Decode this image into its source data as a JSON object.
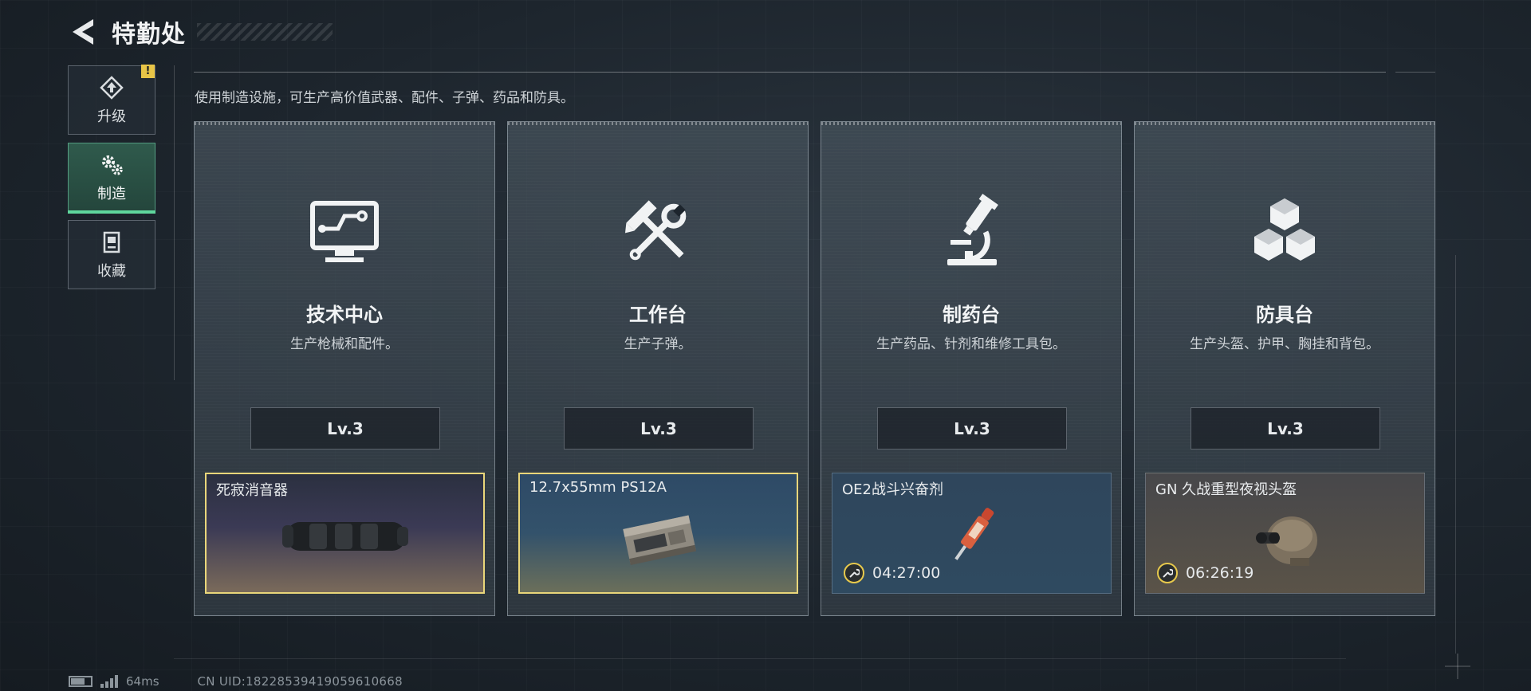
{
  "header": {
    "title": "特勤处"
  },
  "sidebar": {
    "items": [
      {
        "label": "升级",
        "icon": "upgrade-icon",
        "active": false,
        "badge": "!"
      },
      {
        "label": "制造",
        "icon": "crafting-gears-icon",
        "active": true
      },
      {
        "label": "收藏",
        "icon": "collection-icon",
        "active": false
      }
    ]
  },
  "main": {
    "description": "使用制造设施，可生产高价值武器、配件、子弹、药品和防具。",
    "cards": [
      {
        "title": "技术中心",
        "subtitle": "生产枪械和配件。",
        "icon": "computer-monitor-icon",
        "level": "Lv.3",
        "item": {
          "name": "死寂消音器",
          "status": "completed",
          "timer": "",
          "image": "suppressor"
        }
      },
      {
        "title": "工作台",
        "subtitle": "生产子弹。",
        "icon": "hammer-wrench-icon",
        "level": "Lv.3",
        "item": {
          "name": "12.7x55mm PS12A",
          "status": "completed",
          "timer": "",
          "image": "ammo-box"
        }
      },
      {
        "title": "制药台",
        "subtitle": "生产药品、针剂和维修工具包。",
        "icon": "microscope-icon",
        "level": "Lv.3",
        "item": {
          "name": "OE2战斗兴奋剂",
          "status": "in-progress",
          "timer": "04:27:00",
          "image": "syringe"
        }
      },
      {
        "title": "防具台",
        "subtitle": "生产头盔、护甲、胸挂和背包。",
        "icon": "armor-cubes-icon",
        "level": "Lv.3",
        "item": {
          "name": "GN 久战重型夜视头盔",
          "status": "in-progress",
          "timer": "06:26:19",
          "image": "nv-helmet"
        }
      }
    ]
  },
  "footer": {
    "ping": "64ms",
    "uid": "CN UID:18228539419059610668"
  },
  "colors": {
    "accent_green": "#5fd69c",
    "completed_border": "#e9d67a",
    "badge_yellow": "#e8c547",
    "timer_ring": "#e7c94c"
  }
}
